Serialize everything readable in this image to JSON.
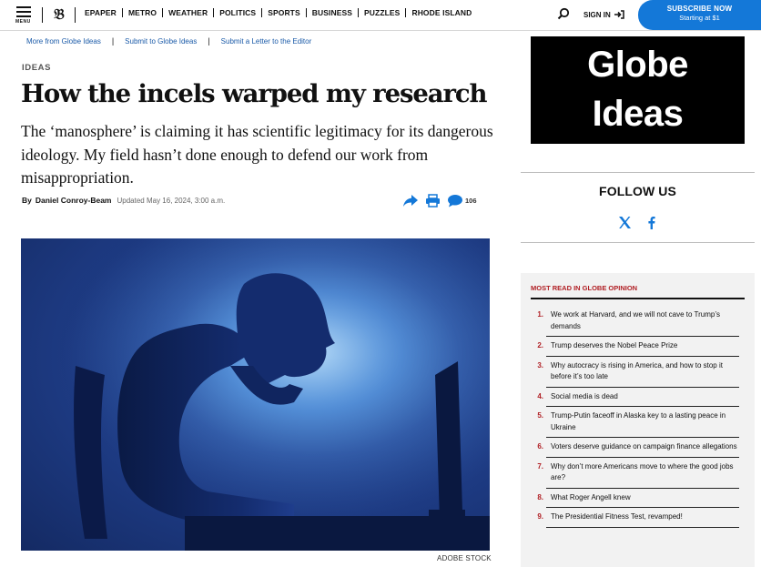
{
  "nav": {
    "menu_label": "MENU",
    "items": [
      "EPAPER",
      "METRO",
      "WEATHER",
      "POLITICS",
      "SPORTS",
      "BUSINESS",
      "PUZZLES",
      "RHODE ISLAND"
    ],
    "signin_label": "SIGN IN",
    "subscribe_label": "SUBSCRIBE NOW",
    "subscribe_sub": "Starting at $1"
  },
  "sublinks": [
    "More from Globe Ideas",
    "Submit to Globe Ideas",
    "Submit a Letter to the Editor"
  ],
  "article": {
    "kicker": "IDEAS",
    "headline": "How the incels warped my research",
    "dek": "The ‘manosphere’ is claiming it has scientific legitimacy for its dangerous ideology. My field hasn’t done enough to defend our work from misappropriation.",
    "byline_by": "By",
    "author": "Daniel Conroy-Beam",
    "updated": "Updated May 16, 2024, 3:00 a.m.",
    "comment_count": "106",
    "image_credit": "ADOBE STOCK"
  },
  "rail": {
    "promo_line1": "Globe",
    "promo_line2": "Ideas",
    "follow_title": "FOLLOW US",
    "most_read_title": "MOST READ IN GLOBE OPINION",
    "most_read": [
      {
        "num": "1.",
        "title": "We work at Harvard, and we will not cave to Trump’s demands"
      },
      {
        "num": "2.",
        "title": "Trump deserves the Nobel Peace Prize"
      },
      {
        "num": "3.",
        "title": "Why autocracy is rising in America, and how to stop it before it’s too late"
      },
      {
        "num": "4.",
        "title": "Social media is dead"
      },
      {
        "num": "5.",
        "title": "Trump-Putin faceoff in Alaska key to a lasting peace in Ukraine"
      },
      {
        "num": "6.",
        "title": "Voters deserve guidance on campaign finance allegations"
      },
      {
        "num": "7.",
        "title": "Why don’t more Americans move to where the good jobs are?"
      },
      {
        "num": "8.",
        "title": "What Roger Angell knew"
      },
      {
        "num": "9.",
        "title": "The Presidential Fitness Test, revamped!"
      }
    ]
  },
  "colors": {
    "accent_blue": "#1478d8",
    "link_blue": "#1a5aa8",
    "most_read_red": "#b01e23"
  }
}
